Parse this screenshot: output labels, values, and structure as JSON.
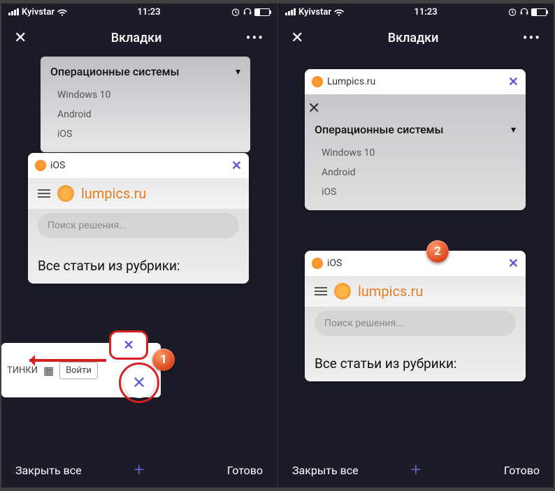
{
  "status": {
    "carrier": "Kyivstar",
    "time": "11:23"
  },
  "header": {
    "close": "✕",
    "title": "Вкладки",
    "more": "•••"
  },
  "footer": {
    "close_all": "Закрыть все",
    "plus": "+",
    "done": "Готово"
  },
  "tab": {
    "ios_title": "iOS",
    "lumpics_title": "Lumpics.ru",
    "close_glyph": "✕",
    "logo_text": "lumpics.ru",
    "search_placeholder": "Поиск решения...",
    "heading": "Все статьи из рубрики:"
  },
  "menu": {
    "title": "Операционные системы",
    "items": [
      "Windows 10",
      "Android",
      "iOS"
    ]
  },
  "fragment": {
    "pics_text": "ТИНКИ",
    "login_text": "Войти"
  },
  "callouts": {
    "one": "1",
    "two": "2"
  }
}
